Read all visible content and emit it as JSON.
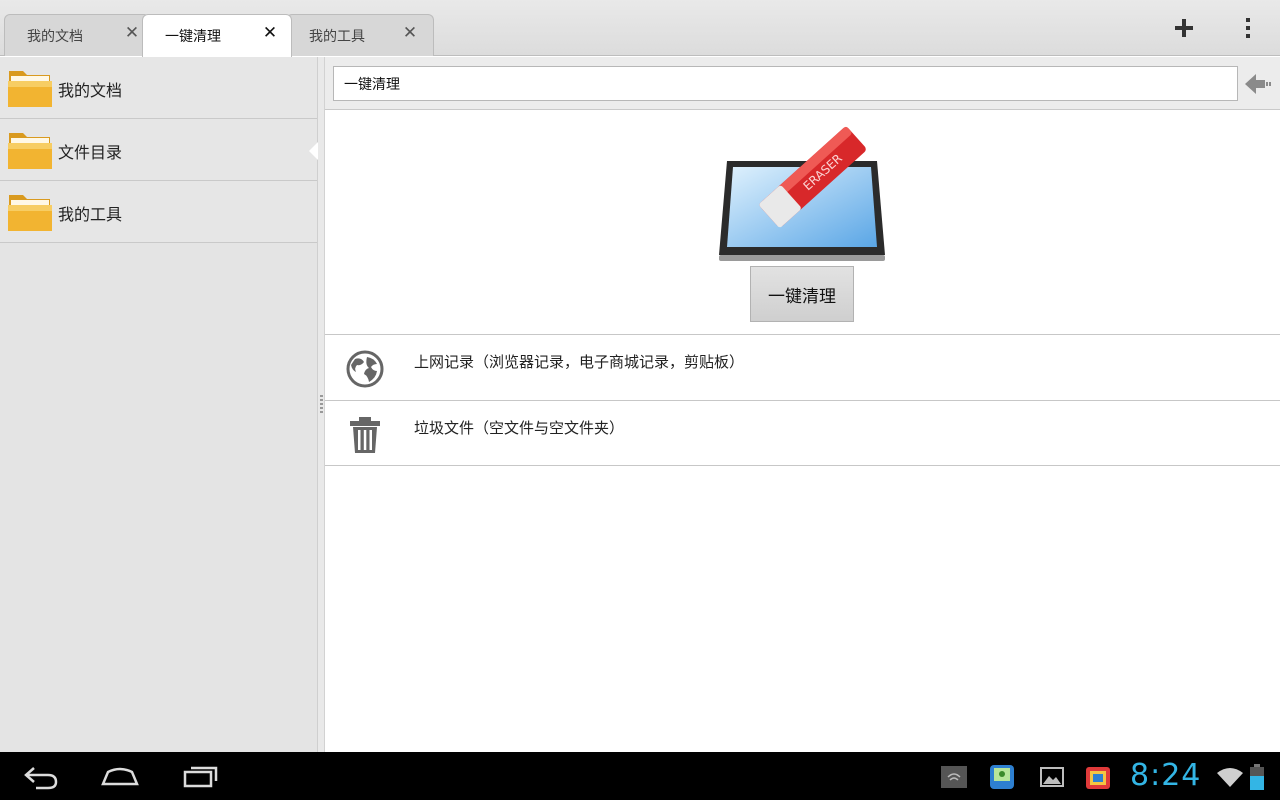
{
  "tabs": [
    {
      "label": "我的文档",
      "active": false
    },
    {
      "label": "一键清理",
      "active": true
    },
    {
      "label": "我的工具",
      "active": false
    }
  ],
  "sidebar": {
    "items": [
      {
        "label": "我的文档",
        "icon": "folder-icon"
      },
      {
        "label": "文件目录",
        "icon": "folder-icon",
        "selected": true
      },
      {
        "label": "我的工具",
        "icon": "folder-icon"
      }
    ]
  },
  "pathbar": {
    "value": "一键清理"
  },
  "clean": {
    "button_label": "一键清理",
    "art_text": "ERASER"
  },
  "rows": [
    {
      "label": "上网记录（浏览器记录，电子商城记录，剪贴板）",
      "icon": "globe-icon"
    },
    {
      "label": "垃圾文件（空文件与空文件夹）",
      "icon": "trash-icon"
    }
  ],
  "statusbar": {
    "time": "8:24"
  },
  "colors": {
    "accent": "#33b5e5",
    "folder": "#f2b431",
    "eraser": "#d8282a"
  }
}
